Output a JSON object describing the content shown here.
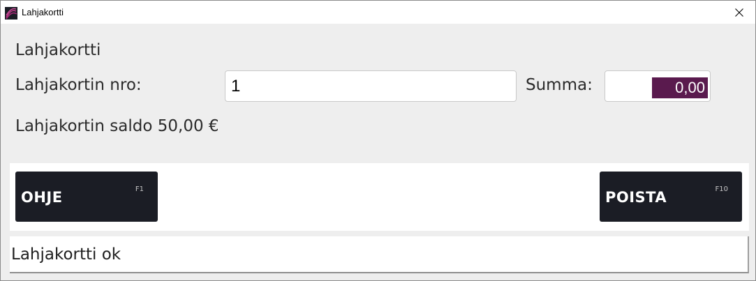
{
  "window": {
    "title": "Lahjakortti",
    "icon": "app-icon",
    "close_icon": "close-icon"
  },
  "form": {
    "heading": "Lahjakortti",
    "nro_label": "Lahjakortin nro:",
    "nro_value": "1",
    "summa_label": "Summa:",
    "summa_value": "0,00",
    "saldo_text": "Lahjakortin saldo 50,00 €"
  },
  "buttons": {
    "ohje": {
      "label": "OHJE",
      "key": "F1"
    },
    "poista": {
      "label": "POISTA",
      "key": "F10"
    }
  },
  "status": {
    "message": "Lahjakortti ok"
  },
  "colors": {
    "accent": "#5a1a4e",
    "button_bg": "#1b1d25",
    "background": "#eeeeee"
  }
}
